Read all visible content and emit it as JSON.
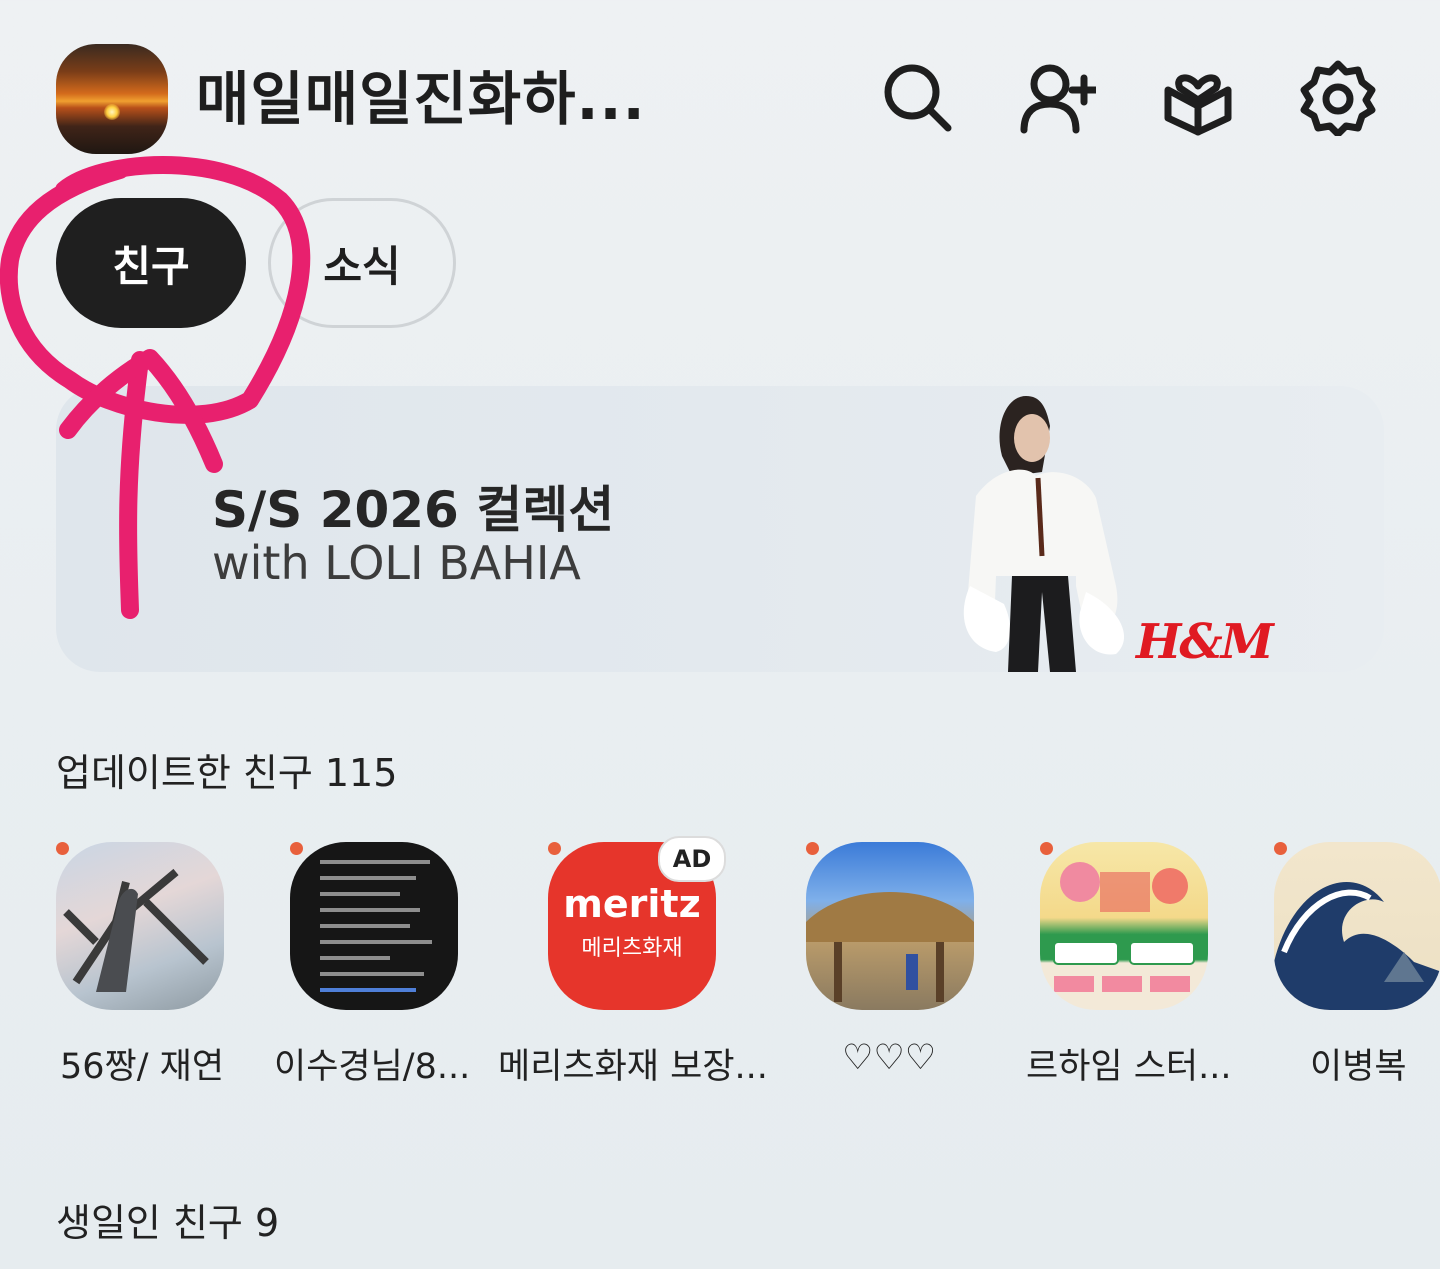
{
  "header": {
    "profile_name": "매일매일진화하...",
    "icons": [
      "search-icon",
      "add-friend-icon",
      "gift-icon",
      "gear-icon"
    ]
  },
  "tabs": [
    {
      "label": "친구",
      "active": true
    },
    {
      "label": "소식",
      "active": false
    }
  ],
  "banner": {
    "title": "S/S 2026 컬렉션",
    "subtitle": "with LOLI BAHIA",
    "brand": "H&M"
  },
  "updated_friends": {
    "title": "업데이트한 친구 115",
    "items": [
      {
        "name": "56짱/ 재연"
      },
      {
        "name": "이수경님/8..."
      },
      {
        "name": "메리츠화재 보장...",
        "badge": "AD",
        "logo_text": "meritz",
        "logo_sub": "메리츠화재"
      },
      {
        "name": "♡♡♡"
      },
      {
        "name": "르하임 스터..."
      },
      {
        "name": "이병복"
      }
    ]
  },
  "birthday_friends": {
    "title": "생일인 친구 9"
  },
  "colors": {
    "accent_dot": "#e8603c",
    "annotation": "#e8206e",
    "active_tab": "#1f1f1f",
    "meritz_red": "#e6352b"
  }
}
